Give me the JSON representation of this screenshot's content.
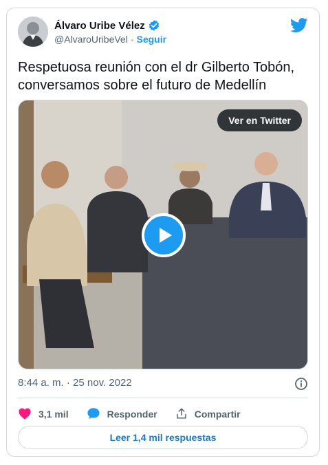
{
  "author": {
    "display_name": "Álvaro Uribe Vélez",
    "handle": "@AlvaroUribeVel",
    "separator": "·",
    "follow_label": "Seguir"
  },
  "tweet": {
    "text": "Respetuosa reunión con el dr Gilberto Tobón, conversamos sobre el futuro de Medellín"
  },
  "media": {
    "view_on_twitter_label": "Ver en Twitter"
  },
  "meta": {
    "timestamp": "8:44 a. m. · 25 nov. 2022"
  },
  "actions": {
    "likes_count": "3,1 mil",
    "reply_label": "Responder",
    "share_label": "Compartir"
  },
  "replies": {
    "read_replies_label": "Leer 1,4 mil respuestas"
  },
  "colors": {
    "accent": "#1d9bf0",
    "like": "#f91880",
    "border": "#cfd9de",
    "muted_text": "#536471"
  }
}
